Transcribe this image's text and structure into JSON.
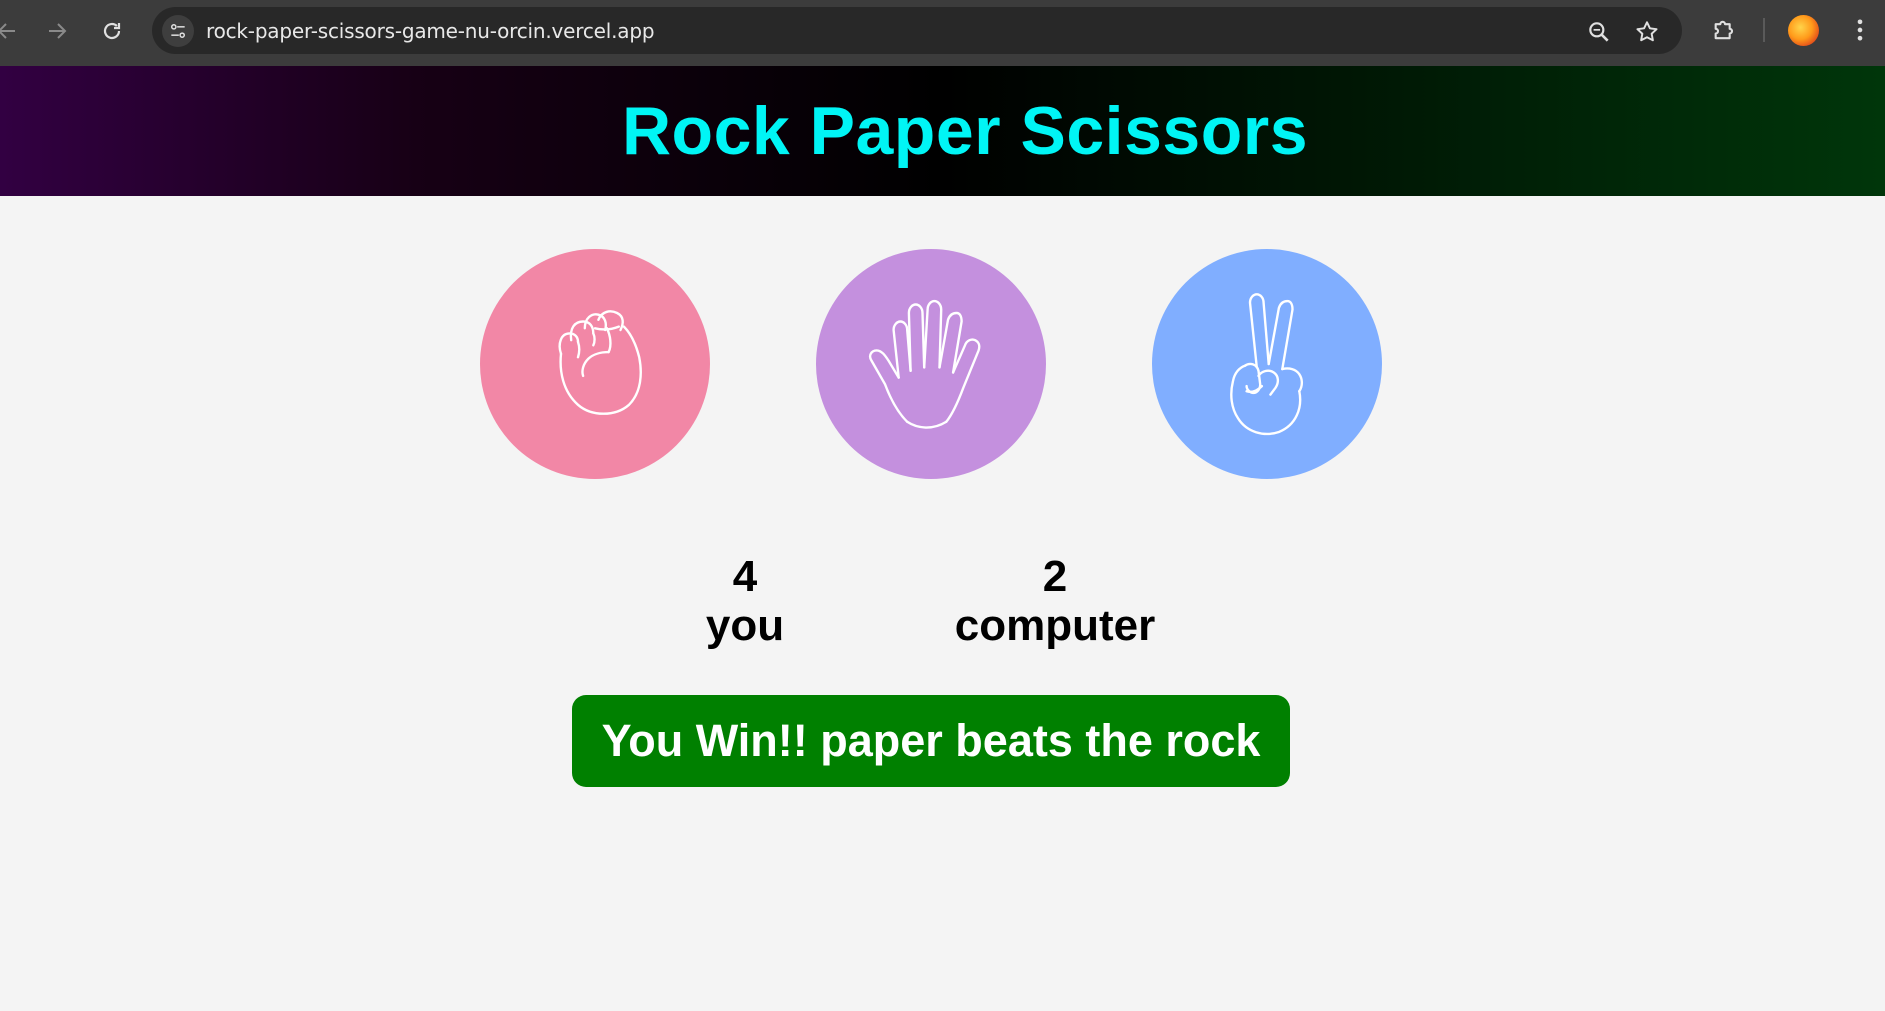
{
  "browser": {
    "url": "rock-paper-scissors-game-nu-orcin.vercel.app",
    "icons": [
      "back-icon",
      "forward-icon",
      "reload-icon",
      "site-info-icon",
      "zoom-icon",
      "bookmark-star-icon",
      "extensions-icon",
      "profile-avatar",
      "menu-icon"
    ]
  },
  "header": {
    "title": "Rock Paper Scissors"
  },
  "choices": [
    {
      "id": "rock",
      "icon": "fist-hand-icon",
      "color": "#f287a6"
    },
    {
      "id": "paper",
      "icon": "open-hand-icon",
      "color": "#c490de"
    },
    {
      "id": "scissors",
      "icon": "peace-hand-icon",
      "color": "#80aeff"
    }
  ],
  "score": {
    "user": {
      "value": "4",
      "label": "you"
    },
    "computer": {
      "value": "2",
      "label": "computer"
    }
  },
  "message": {
    "text": "You Win!! paper beats the rock",
    "color": "#008000"
  },
  "colors": {
    "title": "#00f5f5",
    "background": "#f4f4f4"
  }
}
